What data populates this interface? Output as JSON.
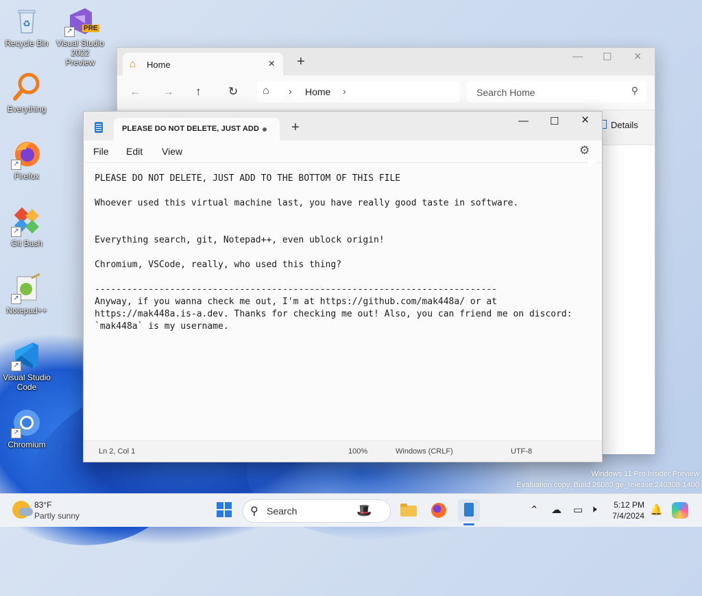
{
  "desktop": {
    "icons": [
      {
        "label": "Recycle Bin"
      },
      {
        "label": "Visual Studio 2022 Preview",
        "badge": "PRE"
      },
      {
        "label": "Everything"
      },
      {
        "label": "Firefox"
      },
      {
        "label": "Git Bash"
      },
      {
        "label": "Notepad++"
      },
      {
        "label": "Visual Studio Code"
      },
      {
        "label": "Chromium"
      }
    ],
    "watermark": {
      "line1": "Windows 11 Pro Insider Preview",
      "line2": "Evaluation copy. Build 26080.ge_release.240308-1400"
    }
  },
  "explorer": {
    "tab_title": "Home",
    "breadcrumb": "Home",
    "search_placeholder": "Search Home",
    "details_label": "Details"
  },
  "notepad": {
    "tab_title": "PLEASE DO NOT DELETE, JUST ADD",
    "menu": [
      "File",
      "Edit",
      "View"
    ],
    "content": "PLEASE DO NOT DELETE, JUST ADD TO THE BOTTOM OF THIS FILE\n\nWhoever used this virtual machine last, you have really good taste in software.\n\n\nEverything search, git, Notepad++, even ublock origin!\n\nChromium, VSCode, really, who used this thing?\n\n---------------------------------------------------------------------------\nAnyway, if you wanna check me out, I'm at https://github.com/mak448a/ or at\nhttps://mak448a.is-a.dev. Thanks for checking me out! Also, you can friend me on discord:\n`mak448a` is my username.",
    "status": {
      "position": "Ln 2, Col 1",
      "zoom": "100%",
      "line_ending": "Windows (CRLF)",
      "encoding": "UTF-8"
    }
  },
  "taskbar": {
    "weather_temp": "83°F",
    "weather_desc": "Partly sunny",
    "search_label": "Search",
    "time": "5:12 PM",
    "date": "7/4/2024"
  },
  "colors": {
    "accent": "#2a7ae2",
    "notepad_icon": "#2f7fd1",
    "home_icon": "#e07b2a"
  }
}
